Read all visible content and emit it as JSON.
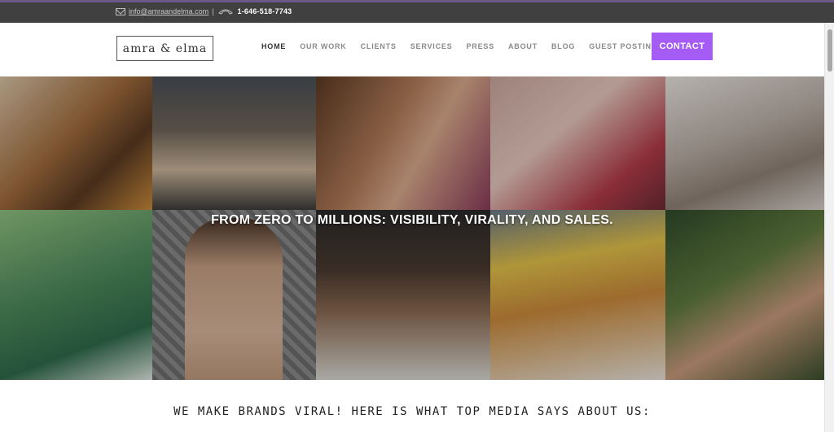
{
  "topbar": {
    "email": "info@amraandelma.com",
    "separator": "|",
    "phone": "1-646-518-7743",
    "mail_icon": "mail-icon",
    "phone_icon": "phone-icon"
  },
  "header": {
    "logo_text": "amra & elma",
    "nav": [
      {
        "label": "HOME",
        "active": true
      },
      {
        "label": "OUR WORK"
      },
      {
        "label": "CLIENTS"
      },
      {
        "label": "SERVICES"
      },
      {
        "label": "PRESS"
      },
      {
        "label": "ABOUT"
      },
      {
        "label": "BLOG"
      },
      {
        "label": "GUEST POSTING"
      }
    ],
    "contact_label": "CONTACT",
    "accent": "#a45cf5"
  },
  "hero": {
    "title": "FROM ZERO TO MILLIONS: VISIBILITY, VIRALITY, AND SALES."
  },
  "section": {
    "tagline": "WE MAKE BRANDS VIRAL! HERE IS WHAT TOP MEDIA SAYS ABOUT US:"
  }
}
